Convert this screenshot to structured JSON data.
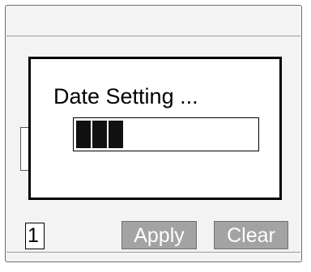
{
  "dialog": {
    "title": "Date Setting ..."
  },
  "progress": {
    "filled_blocks": 3,
    "total_blocks": 11
  },
  "footer": {
    "page_number": "1",
    "apply_label": "Apply",
    "clear_label": "Clear"
  },
  "colors": {
    "screen_background": "#f3f3f3",
    "button_background": "#a3a3a3",
    "button_text": "#ffffff",
    "progress_fill": "#111111"
  }
}
